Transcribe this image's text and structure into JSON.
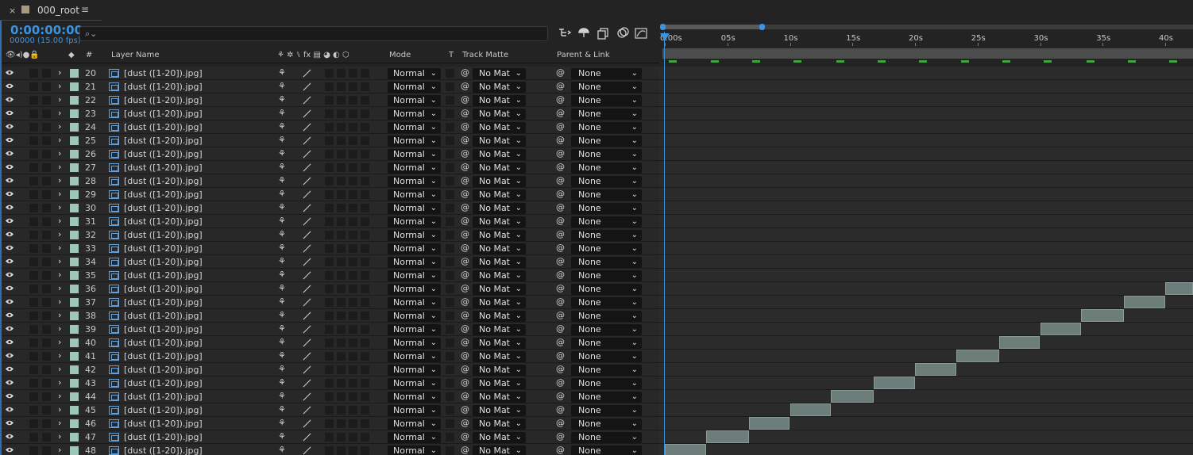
{
  "tab": {
    "close": "×",
    "title": "000_root",
    "menu": "≡"
  },
  "header": {
    "timecode": "0:00:00:00",
    "fps": "00000 (15.00 fps)",
    "search_icon": "⌕⌄"
  },
  "columns": {
    "av": "👁◂)●🔒",
    "label": "◆",
    "num": "#",
    "layer_name": "Layer Name",
    "switches": "⚘ ✲ ⑊ fx ▤ ◕ ◐ ⬡",
    "mode": "Mode",
    "t": "T",
    "track_matte": "Track Matte",
    "parent": "Parent & Link"
  },
  "ruler": [
    "0:00s",
    "05s",
    "10s",
    "15s",
    "20s",
    "25s",
    "30s",
    "35s",
    "40s"
  ],
  "rows": [
    {
      "num": "20",
      "name": "[dust ([1-20]).jpg]",
      "mode": "Normal",
      "matte": "No Mat",
      "parent": "None"
    },
    {
      "num": "21",
      "name": "[dust ([1-20]).jpg]",
      "mode": "Normal",
      "matte": "No Mat",
      "parent": "None"
    },
    {
      "num": "22",
      "name": "[dust ([1-20]).jpg]",
      "mode": "Normal",
      "matte": "No Mat",
      "parent": "None"
    },
    {
      "num": "23",
      "name": "[dust ([1-20]).jpg]",
      "mode": "Normal",
      "matte": "No Mat",
      "parent": "None"
    },
    {
      "num": "24",
      "name": "[dust ([1-20]).jpg]",
      "mode": "Normal",
      "matte": "No Mat",
      "parent": "None"
    },
    {
      "num": "25",
      "name": "[dust ([1-20]).jpg]",
      "mode": "Normal",
      "matte": "No Mat",
      "parent": "None"
    },
    {
      "num": "26",
      "name": "[dust ([1-20]).jpg]",
      "mode": "Normal",
      "matte": "No Mat",
      "parent": "None"
    },
    {
      "num": "27",
      "name": "[dust ([1-20]).jpg]",
      "mode": "Normal",
      "matte": "No Mat",
      "parent": "None"
    },
    {
      "num": "28",
      "name": "[dust ([1-20]).jpg]",
      "mode": "Normal",
      "matte": "No Mat",
      "parent": "None"
    },
    {
      "num": "29",
      "name": "[dust ([1-20]).jpg]",
      "mode": "Normal",
      "matte": "No Mat",
      "parent": "None"
    },
    {
      "num": "30",
      "name": "[dust ([1-20]).jpg]",
      "mode": "Normal",
      "matte": "No Mat",
      "parent": "None"
    },
    {
      "num": "31",
      "name": "[dust ([1-20]).jpg]",
      "mode": "Normal",
      "matte": "No Mat",
      "parent": "None"
    },
    {
      "num": "32",
      "name": "[dust ([1-20]).jpg]",
      "mode": "Normal",
      "matte": "No Mat",
      "parent": "None"
    },
    {
      "num": "33",
      "name": "[dust ([1-20]).jpg]",
      "mode": "Normal",
      "matte": "No Mat",
      "parent": "None"
    },
    {
      "num": "34",
      "name": "[dust ([1-20]).jpg]",
      "mode": "Normal",
      "matte": "No Mat",
      "parent": "None"
    },
    {
      "num": "35",
      "name": "[dust ([1-20]).jpg]",
      "mode": "Normal",
      "matte": "No Mat",
      "parent": "None"
    },
    {
      "num": "36",
      "name": "[dust ([1-20]).jpg]",
      "mode": "Normal",
      "matte": "No Mat",
      "parent": "None"
    },
    {
      "num": "37",
      "name": "[dust ([1-20]).jpg]",
      "mode": "Normal",
      "matte": "No Mat",
      "parent": "None"
    },
    {
      "num": "38",
      "name": "[dust ([1-20]).jpg]",
      "mode": "Normal",
      "matte": "No Mat",
      "parent": "None"
    },
    {
      "num": "39",
      "name": "[dust ([1-20]).jpg]",
      "mode": "Normal",
      "matte": "No Mat",
      "parent": "None"
    },
    {
      "num": "40",
      "name": "[dust ([1-20]).jpg]",
      "mode": "Normal",
      "matte": "No Mat",
      "parent": "None"
    },
    {
      "num": "41",
      "name": "[dust ([1-20]).jpg]",
      "mode": "Normal",
      "matte": "No Mat",
      "parent": "None"
    },
    {
      "num": "42",
      "name": "[dust ([1-20]).jpg]",
      "mode": "Normal",
      "matte": "No Mat",
      "parent": "None"
    },
    {
      "num": "43",
      "name": "[dust ([1-20]).jpg]",
      "mode": "Normal",
      "matte": "No Mat",
      "parent": "None"
    },
    {
      "num": "44",
      "name": "[dust ([1-20]).jpg]",
      "mode": "Normal",
      "matte": "No Mat",
      "parent": "None"
    },
    {
      "num": "45",
      "name": "[dust ([1-20]).jpg]",
      "mode": "Normal",
      "matte": "No Mat",
      "parent": "None"
    },
    {
      "num": "46",
      "name": "[dust ([1-20]).jpg]",
      "mode": "Normal",
      "matte": "No Mat",
      "parent": "None"
    },
    {
      "num": "47",
      "name": "[dust ([1-20]).jpg]",
      "mode": "Normal",
      "matte": "No Mat",
      "parent": "None"
    },
    {
      "num": "48",
      "name": "[dust ([1-20]).jpg]",
      "mode": "Normal",
      "matte": "No Mat",
      "parent": "None"
    }
  ],
  "bars": [
    {
      "row": 16,
      "start_s": 40.0,
      "end_s": 43.3
    },
    {
      "row": 17,
      "start_s": 36.7,
      "end_s": 40.0
    },
    {
      "row": 18,
      "start_s": 33.3,
      "end_s": 36.7
    },
    {
      "row": 19,
      "start_s": 30.0,
      "end_s": 33.3
    },
    {
      "row": 20,
      "start_s": 26.7,
      "end_s": 30.0
    },
    {
      "row": 21,
      "start_s": 23.3,
      "end_s": 26.7
    },
    {
      "row": 22,
      "start_s": 20.0,
      "end_s": 23.3
    },
    {
      "row": 23,
      "start_s": 16.7,
      "end_s": 20.0
    },
    {
      "row": 24,
      "start_s": 13.3,
      "end_s": 16.7
    },
    {
      "row": 25,
      "start_s": 10.0,
      "end_s": 13.3
    },
    {
      "row": 26,
      "start_s": 6.7,
      "end_s": 10.0
    },
    {
      "row": 27,
      "start_s": 3.3,
      "end_s": 6.7
    },
    {
      "row": 28,
      "start_s": 0.0,
      "end_s": 3.3
    }
  ],
  "markers_s": [
    0.3,
    3.7,
    7.0,
    10.3,
    13.7,
    17.0,
    20.3,
    23.7,
    27.0,
    30.3,
    33.7,
    37.0,
    40.3
  ],
  "colors": {
    "accent": "#3c93e0",
    "layer_label": "#9ec7b8",
    "layer_bar": "#6d7d7a",
    "marker": "#3da53d"
  }
}
